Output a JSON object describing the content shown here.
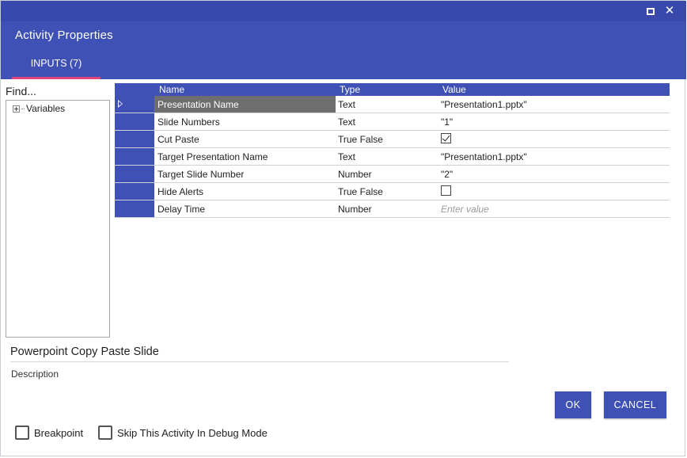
{
  "window": {
    "title": "Activity Properties",
    "maximize_icon": "maximize-icon",
    "close_icon": "close-icon",
    "close_glyph": "✕"
  },
  "tabs": [
    {
      "label": "INPUTS (7)",
      "active": true
    }
  ],
  "finder": {
    "label": "Find...",
    "tree": [
      {
        "label": "Variables",
        "expander": "plus-icon"
      }
    ]
  },
  "grid": {
    "headers": {
      "name": "Name",
      "type": "Type",
      "value": "Value"
    },
    "rows": [
      {
        "name": "Presentation Name",
        "type": "Text",
        "value": "\"Presentation1.pptx\""
      },
      {
        "name": "Slide Numbers",
        "type": "Text",
        "value": "\"1\""
      },
      {
        "name": "Cut Paste",
        "type": "True False",
        "value": "",
        "checked": true
      },
      {
        "name": "Target Presentation Name",
        "type": "Text",
        "value": "\"Presentation1.pptx\""
      },
      {
        "name": "Target Slide Number",
        "type": "Number",
        "value": "\"2\""
      },
      {
        "name": "Hide Alerts",
        "type": "True False",
        "value": "",
        "checked": false
      },
      {
        "name": "Delay Time",
        "type": "Number",
        "value": "",
        "placeholder": "Enter value"
      }
    ]
  },
  "activity": {
    "name": "Powerpoint Copy Paste Slide",
    "description_label": "Description"
  },
  "buttons": {
    "ok": "OK",
    "cancel": "CANCEL"
  },
  "options": {
    "breakpoint": "Breakpoint",
    "skip_debug": "Skip This Activity In Debug Mode"
  },
  "colors": {
    "header": "#3f51b5",
    "tab_indicator": "#e0457b",
    "selected_row": "#6e6e6e"
  }
}
